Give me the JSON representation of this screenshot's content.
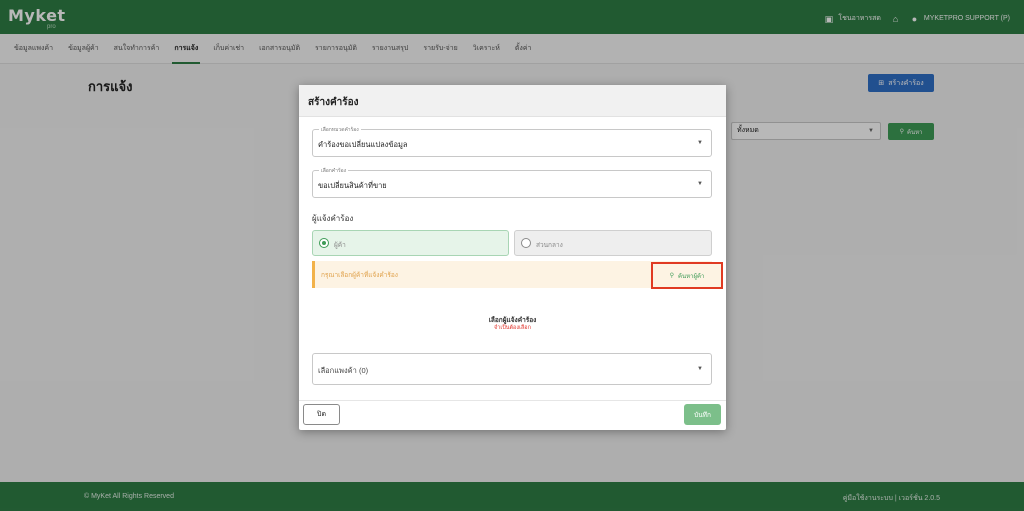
{
  "app": {
    "logo": "Myket",
    "logo_sub": "pro"
  },
  "topbar": {
    "items": [
      {
        "icon": "shop-icon",
        "label": "โชนอาหารสด"
      },
      {
        "icon": "home-icon",
        "label": ""
      },
      {
        "icon": "user-icon",
        "label": "MYKETPRO SUPPORT (P)"
      }
    ]
  },
  "menu": {
    "items": [
      {
        "label": "ข้อมูลแพงค้า",
        "active": false
      },
      {
        "label": "ข้อมูลผู้ค้า",
        "active": false
      },
      {
        "label": "สนใจทำการค้า",
        "active": false
      },
      {
        "label": "การแจ้ง",
        "active": true
      },
      {
        "label": "เก็บค่าเช่า",
        "active": false
      },
      {
        "label": "เอกสารอนุมัติ",
        "active": false
      },
      {
        "label": "รายการอนุมัติ",
        "active": false
      },
      {
        "label": "รายงานสรุป",
        "active": false
      },
      {
        "label": "รายรับ-จ่าย",
        "active": false
      },
      {
        "label": "วิเคราะห์",
        "active": false
      },
      {
        "label": "ตั้งค่า",
        "active": false
      }
    ]
  },
  "page": {
    "title": "การแจ้ง",
    "create_button": "สร้างคำร้อง",
    "filter_value": "ทั้งหมด",
    "search_button": "ค้นหา"
  },
  "modal": {
    "title": "สร้างคำร้อง",
    "category_field": {
      "label": "เลือกหมวดคำร้อง",
      "value": "คำร้องขอเปลี่ยนแปลงข้อมูล"
    },
    "request_field": {
      "label": "เลือกคำร้อง",
      "value": "ขอเปลี่ยนสินค้าที่ขาย"
    },
    "requester_section": "ผู้แจ้งคำร้อง",
    "radio_vendor": "ผู้ค้า",
    "radio_central": "ส่วนกลาง",
    "warning_text": "กรุณาเลือกผู้ค้าที่แจ้งคำร้อง",
    "find_vendor_button": "ค้นหาผู้ค้า",
    "pick_title": "เลือกผู้แจ้งคำร้อง",
    "pick_required": "จำเป็นต้องเลือก",
    "shop_field": "เลือกแพงค้า (0)",
    "close_button": "ปิด",
    "save_button": "บันทึก"
  },
  "footer": {
    "copyright": "© MyKet All Rights Reserved",
    "version": "คู่มือใช้งานระบบ | เวอร์ชั่น 2.0.5"
  },
  "colors": {
    "brand_green": "#2f7d45",
    "accent_blue": "#2e6fc7",
    "warning_orange": "#f2b24a",
    "highlight_red": "#e03a22"
  }
}
